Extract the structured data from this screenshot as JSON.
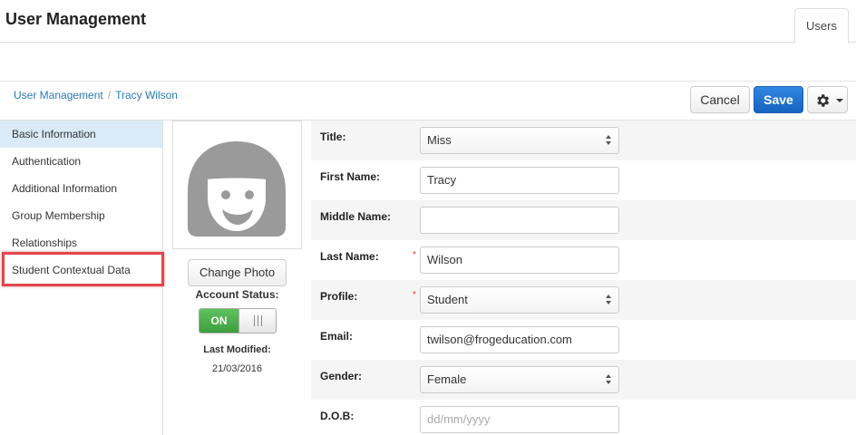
{
  "header": {
    "title": "User Management",
    "tab_label": "Users"
  },
  "breadcrumb": {
    "items": [
      "User Management",
      "Tracy Wilson"
    ],
    "separator": "/"
  },
  "actions": {
    "cancel_label": "Cancel",
    "save_label": "Save",
    "settings_icon": "gear-icon"
  },
  "colors": {
    "accent": "#1565c0",
    "active_bg": "#d9ebf7",
    "highlight": "#e0474c",
    "toggle_on": "#4cae4c"
  },
  "sidebar": {
    "items": [
      {
        "label": "Basic Information",
        "active": true
      },
      {
        "label": "Authentication"
      },
      {
        "label": "Additional Information"
      },
      {
        "label": "Group Membership"
      },
      {
        "label": "Relationships"
      },
      {
        "label": "Student Contextual Data",
        "highlighted": true
      }
    ]
  },
  "profile": {
    "change_photo_label": "Change Photo",
    "account_status_label": "Account Status:",
    "toggle_on_label": "ON",
    "last_modified_label": "Last Modified:",
    "last_modified_value": "21/03/2016"
  },
  "form": {
    "title": {
      "label": "Title:",
      "value": "Miss"
    },
    "first_name": {
      "label": "First Name:",
      "value": "Tracy"
    },
    "middle_name": {
      "label": "Middle Name:",
      "value": ""
    },
    "last_name": {
      "label": "Last Name:",
      "value": "Wilson",
      "required_mark": "*"
    },
    "profile": {
      "label": "Profile:",
      "value": "Student",
      "required_mark": "*"
    },
    "email": {
      "label": "Email:",
      "value": "twilson@frogeducation.com"
    },
    "gender": {
      "label": "Gender:",
      "value": "Female"
    },
    "dob": {
      "label": "D.O.B:",
      "placeholder": "dd/mm/yyyy"
    }
  }
}
